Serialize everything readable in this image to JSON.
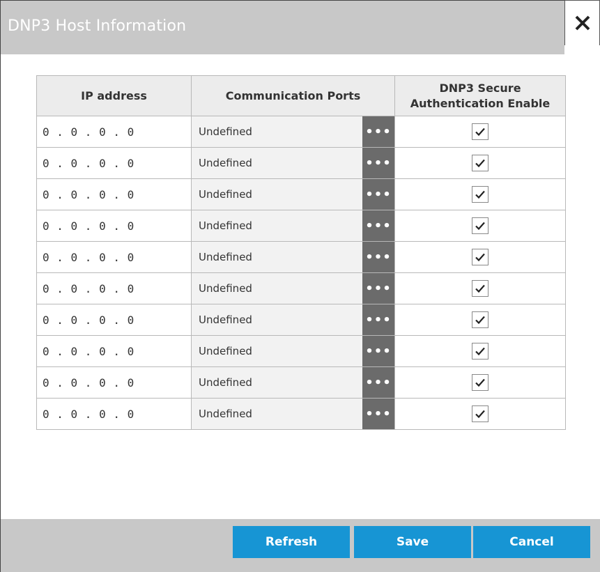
{
  "window": {
    "title": "DNP3 Host Information",
    "close_icon": "close-icon"
  },
  "table": {
    "headers": {
      "ip": "IP address",
      "ports": "Communication Ports",
      "auth_line1": "DNP3 Secure",
      "auth_line2": "Authentication Enable"
    },
    "rows": [
      {
        "ip": "0 . 0 . 0 . 0",
        "port": "Undefined",
        "more": "•••",
        "auth_enabled": true
      },
      {
        "ip": "0 . 0 . 0 . 0",
        "port": "Undefined",
        "more": "•••",
        "auth_enabled": true
      },
      {
        "ip": "0 . 0 . 0 . 0",
        "port": "Undefined",
        "more": "•••",
        "auth_enabled": true
      },
      {
        "ip": "0 . 0 . 0 . 0",
        "port": "Undefined",
        "more": "•••",
        "auth_enabled": true
      },
      {
        "ip": "0 . 0 . 0 . 0",
        "port": "Undefined",
        "more": "•••",
        "auth_enabled": true
      },
      {
        "ip": "0 . 0 . 0 . 0",
        "port": "Undefined",
        "more": "•••",
        "auth_enabled": true
      },
      {
        "ip": "0 . 0 . 0 . 0",
        "port": "Undefined",
        "more": "•••",
        "auth_enabled": true
      },
      {
        "ip": "0 . 0 . 0 . 0",
        "port": "Undefined",
        "more": "•••",
        "auth_enabled": true
      },
      {
        "ip": "0 . 0 . 0 . 0",
        "port": "Undefined",
        "more": "•••",
        "auth_enabled": true
      },
      {
        "ip": "0 . 0 . 0 . 0",
        "port": "Undefined",
        "more": "•••",
        "auth_enabled": true
      }
    ]
  },
  "footer": {
    "refresh_label": "Refresh",
    "save_label": "Save",
    "cancel_label": "Cancel"
  },
  "colors": {
    "titlebar": "#c8c8c8",
    "button": "#1795d4",
    "more_button": "#6b6b6b"
  }
}
